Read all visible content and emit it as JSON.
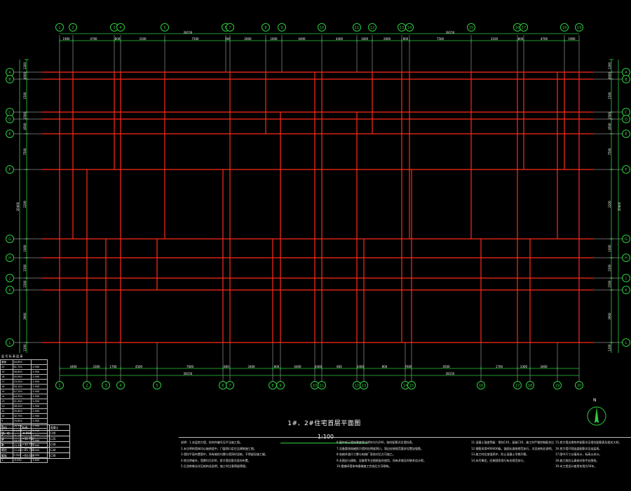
{
  "drawing": {
    "title": "1#、2#住宅首层平面图",
    "scale": "1:100"
  },
  "top_axes": [
    "1",
    "2",
    "3",
    "4",
    "5",
    "6",
    "7",
    "8",
    "9",
    "10",
    "11",
    "12",
    "13",
    "14",
    "15",
    "16",
    "17",
    "18",
    "19",
    "20"
  ],
  "bottom_axes": [
    "1",
    "2",
    "3",
    "4",
    "5",
    "6",
    "7",
    "8",
    "9",
    "10",
    "11",
    "12",
    "13",
    "14",
    "15",
    "16",
    "17",
    "18",
    "19",
    "20",
    "21"
  ],
  "left_axes": [
    "A",
    "B",
    "C",
    "D",
    "E",
    "F",
    "G",
    "H",
    "J",
    "K",
    "L"
  ],
  "right_axes": [
    "A",
    "B",
    "C",
    "D",
    "E",
    "F",
    "G",
    "H",
    "J",
    "K",
    "L"
  ],
  "top_overall_dims": [
    "28150",
    "28150"
  ],
  "top_dims": [
    "1900",
    "4700",
    "800",
    "3100",
    "7500",
    "800",
    "2600",
    "1600",
    "4400",
    "4400",
    "1600",
    "2600",
    "800",
    "7500",
    "3100",
    "800",
    "4700",
    "1900"
  ],
  "bottom_overall_dims": [
    "28150",
    "28150"
  ],
  "bottom_dims": [
    "3400",
    "3300",
    "1700",
    "4500",
    "7600",
    "800",
    "3400",
    "800",
    "4400",
    "4400",
    "800",
    "3400",
    "800",
    "7600",
    "4500",
    "1700",
    "3300",
    "3400"
  ],
  "left_overall_dim": "20400",
  "left_dims": [
    "1200",
    "4000",
    "1500",
    "1500",
    "4500",
    "7500",
    "2200",
    "1000",
    "1500",
    "1500",
    "3900",
    "1200"
  ],
  "right_overall_dim": "20400",
  "right_dims": [
    "1200",
    "4000",
    "1500",
    "1500",
    "4500",
    "7500",
    "2200",
    "1000",
    "1500",
    "1500",
    "3900",
    "1200"
  ],
  "north": {
    "label": "N"
  },
  "level_table": {
    "heading": "层 号  标 高  层 高",
    "rows": [
      [
        "屋面",
        "64.650",
        ""
      ],
      [
        "20",
        "61.750",
        "2.900"
      ],
      [
        "19",
        "58.850",
        "2.900"
      ],
      [
        "18",
        "55.950",
        "2.900"
      ],
      [
        "17",
        "53.050",
        "2.900"
      ],
      [
        "16",
        "50.150",
        "2.900"
      ],
      [
        "15",
        "47.250",
        "2.900"
      ],
      [
        "14",
        "44.350",
        "2.900"
      ],
      [
        "13",
        "41.450",
        "2.900"
      ],
      [
        "12",
        "38.550",
        "2.900"
      ],
      [
        "11",
        "35.650",
        "2.900"
      ],
      [
        "10",
        "32.750",
        "2.900"
      ],
      [
        "9",
        "29.850",
        "2.900"
      ],
      [
        "8",
        "26.950",
        "2.900"
      ],
      [
        "7",
        "24.050",
        "2.900"
      ],
      [
        "6",
        "21.150",
        "2.900"
      ],
      [
        "5",
        "18.250",
        "2.900"
      ],
      [
        "4",
        "15.350",
        "2.900"
      ],
      [
        "3",
        "12.450",
        "2.900"
      ],
      [
        "2",
        "9.550",
        "2.900"
      ],
      [
        "1",
        "-0.050",
        "3.600"
      ]
    ]
  },
  "material_table": {
    "rows": [
      [
        "部位",
        "标高",
        "混凝土"
      ],
      [
        "墙、柱",
        "-0.050~",
        "C40"
      ],
      [
        "梁",
        "~32.750",
        "C35"
      ],
      [
        "板",
        "~32.750",
        "C30"
      ],
      [
        "墙柱",
        "~61.750",
        "C30"
      ],
      [
        "梁板",
        "~64.650",
        "C30"
      ]
    ]
  },
  "notes": {
    "col1": [
      "说明：1.本层剪力墙、柱构件编号见平法施工图。",
      "2.未注明的墙体均以轴线居中，门窗洞口定位见建筑施工图。",
      "3.墙柱平面布置图中，所有暗柱均需与墙同时浇筑，不得留设施工缝。",
      "4.除注明者外，墙厚均为200，剪力墙拉筋为双向布置。",
      "5.后浇带做法详见结构总说明，施工时注意预留预埋。"
    ],
    "col2": [
      "6.图中所示墙体厚度除注明外均为200，暗柱配筋详见墙柱表。",
      "7.设备管线穿越剪力墙时应预留洞口，洞边应按规范要求设置加强筋。",
      "8.电梯井道尺寸需与电梯厂家核对后方可施工。",
      "9.本图应与建筑、设备等专业图纸配合使用，如有矛盾及时联系设计院。",
      "10.楼梯间墙体待楼梯施工完成后方可砌筑。"
    ],
    "col3": [
      "11.混凝土强度等级：墙柱C40，梁板C30，施工时严格控制配合比。",
      "12.钢筋采用HRB400级，锚固长度按规范执行，详见结构总说明。",
      "13.施工时应加强养护，防止混凝土早期开裂。",
      "14.未尽事宜，应按国家现行有关规范执行。"
    ],
    "col4": [
      "15.剪力墙边缘构件配筋详见墙柱配筋表及相关大样。",
      "16.剪力墙开洞连梁配筋详见连梁表。",
      "17.图中尺寸以毫米计，标高以米计。",
      "18.施工前应认真核对各专业图纸。",
      "19.本工程设计使用年限为50年。"
    ]
  }
}
